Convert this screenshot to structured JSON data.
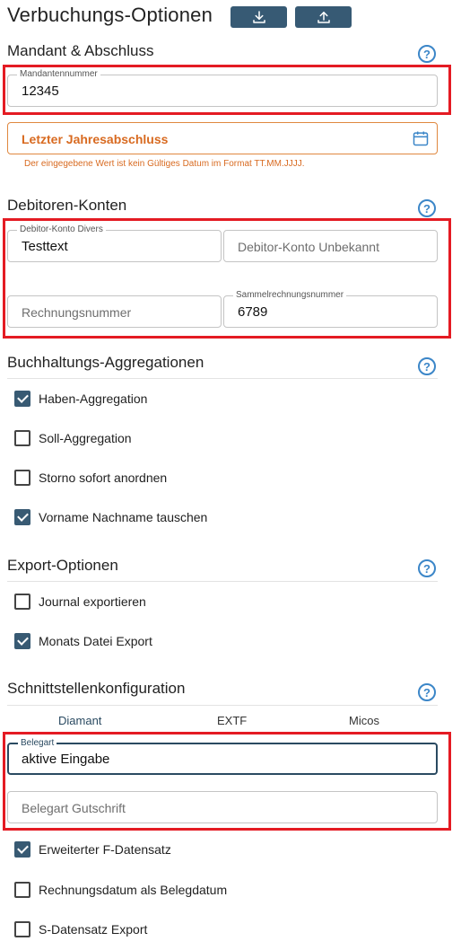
{
  "header": {
    "title": "Verbuchungs-Optionen",
    "download_icon": "download-icon",
    "upload_icon": "upload-icon"
  },
  "sections": {
    "mandant": {
      "title": "Mandant & Abschluss",
      "mandantennummer": {
        "label": "Mandantennummer",
        "value": "12345"
      },
      "jahresabschluss": {
        "placeholder": "Letzter Jahresabschluss",
        "error": "Der eingegebene Wert ist kein Gültiges Datum im Format TT.MM.JJJJ."
      }
    },
    "debitoren": {
      "title": "Debitoren-Konten",
      "divers": {
        "label": "Debitor-Konto Divers",
        "value": "Testtext"
      },
      "unbekannt": {
        "placeholder": "Debitor-Konto Unbekannt"
      },
      "rechnungsnummer": {
        "placeholder": "Rechnungsnummer"
      },
      "sammelrechnungsnummer": {
        "label": "Sammelrechnungsnummer",
        "value": "6789"
      }
    },
    "aggregationen": {
      "title": "Buchhaltungs-Aggregationen",
      "items": [
        {
          "label": "Haben-Aggregation",
          "checked": true
        },
        {
          "label": "Soll-Aggregation",
          "checked": false
        },
        {
          "label": "Storno sofort anordnen",
          "checked": false
        },
        {
          "label": "Vorname Nachname tauschen",
          "checked": true
        }
      ]
    },
    "export": {
      "title": "Export-Optionen",
      "items": [
        {
          "label": "Journal exportieren",
          "checked": false
        },
        {
          "label": "Monats Datei Export",
          "checked": true
        }
      ]
    },
    "schnittstelle": {
      "title": "Schnittstellenkonfiguration",
      "tabs": [
        "Diamant",
        "EXTF",
        "Micos"
      ],
      "active_tab": "Diamant",
      "belegart": {
        "label": "Belegart",
        "value": "aktive Eingabe"
      },
      "belegart_gutschrift": {
        "placeholder": "Belegart Gutschrift"
      },
      "items": [
        {
          "label": "Erweiterter F-Datensatz",
          "checked": true
        },
        {
          "label": "Rechnungsdatum als Belegdatum",
          "checked": false
        },
        {
          "label": "S-Datensatz Export",
          "checked": false
        }
      ]
    }
  },
  "colors": {
    "accent": "#375a74",
    "help": "#3b86c8",
    "error": "#d86a20",
    "highlight": "#e41b23"
  }
}
